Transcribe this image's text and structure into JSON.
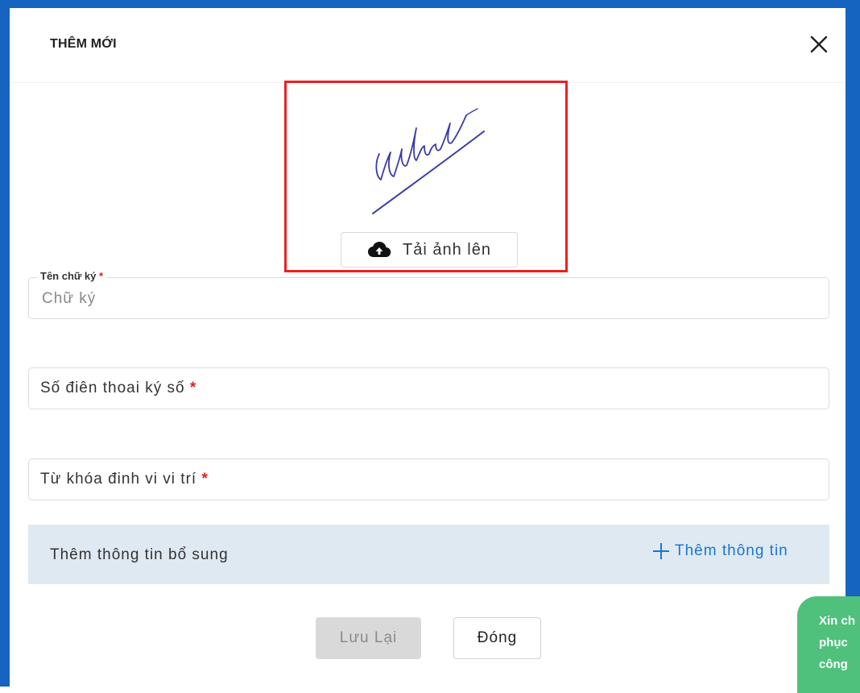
{
  "dialog": {
    "title": "THÊM MỚI"
  },
  "upload": {
    "button_label": "Tải ảnh lên"
  },
  "form": {
    "name_field": {
      "label": "Tên chữ ký",
      "required_mark": "*",
      "placeholder": "Chữ ký",
      "value": ""
    },
    "phone_field": {
      "label": "Số điên thoai ký số",
      "required_mark": "*"
    },
    "keyword_field": {
      "label": "Từ khóa đinh vi vi trí",
      "required_mark": "*"
    }
  },
  "extra_info": {
    "title": "Thêm thông tin bổ sung",
    "add_label": "Thêm thông tin"
  },
  "actions": {
    "save_label": "Lưu Lại",
    "close_label": "Đóng"
  },
  "chat_widget": {
    "lines": [
      "Xin ch",
      "phục",
      "công"
    ]
  },
  "colors": {
    "accent": "#1976d2",
    "background_blue": "#1565c0",
    "highlight_border": "#ee1f1f",
    "required": "#e02020",
    "extra_bar": "#dfe9f2",
    "chat": "#4fc17d",
    "signature_ink": "#3a3aa8"
  },
  "icons": {
    "close": "close-icon",
    "upload": "cloud-upload-icon",
    "add": "plus-icon"
  }
}
